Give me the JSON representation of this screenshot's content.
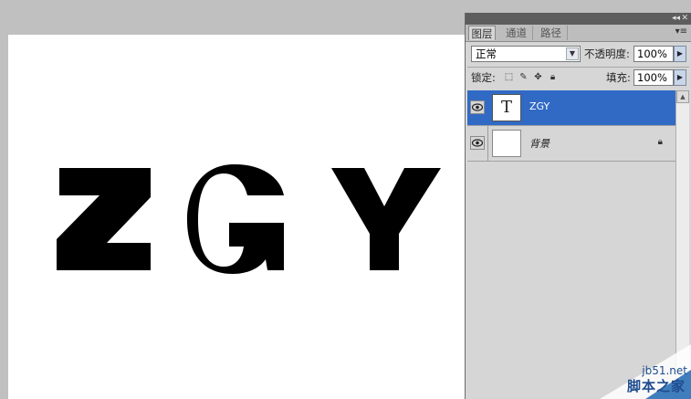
{
  "canvas": {
    "text": "ZGY",
    "letters": [
      "Z",
      "G",
      "Y"
    ]
  },
  "panel": {
    "tabs": [
      "图层",
      "通道",
      "路径"
    ],
    "active_tab": "图层",
    "blend_mode": "正常",
    "opacity_label": "不透明度:",
    "opacity_value": "100%",
    "lock_label": "锁定:",
    "fill_label": "填充:",
    "fill_value": "100%",
    "layers": [
      {
        "name": "ZGY",
        "thumb": "T",
        "selected": true
      },
      {
        "name": "背景",
        "thumb": "",
        "selected": false
      }
    ]
  },
  "watermark": {
    "url": "jb51.net",
    "name": "脚本之家"
  },
  "colors": {
    "selected_layer": "#316ac5",
    "canvas_bg": "#ffffff",
    "workspace": "#c0c0c0"
  }
}
